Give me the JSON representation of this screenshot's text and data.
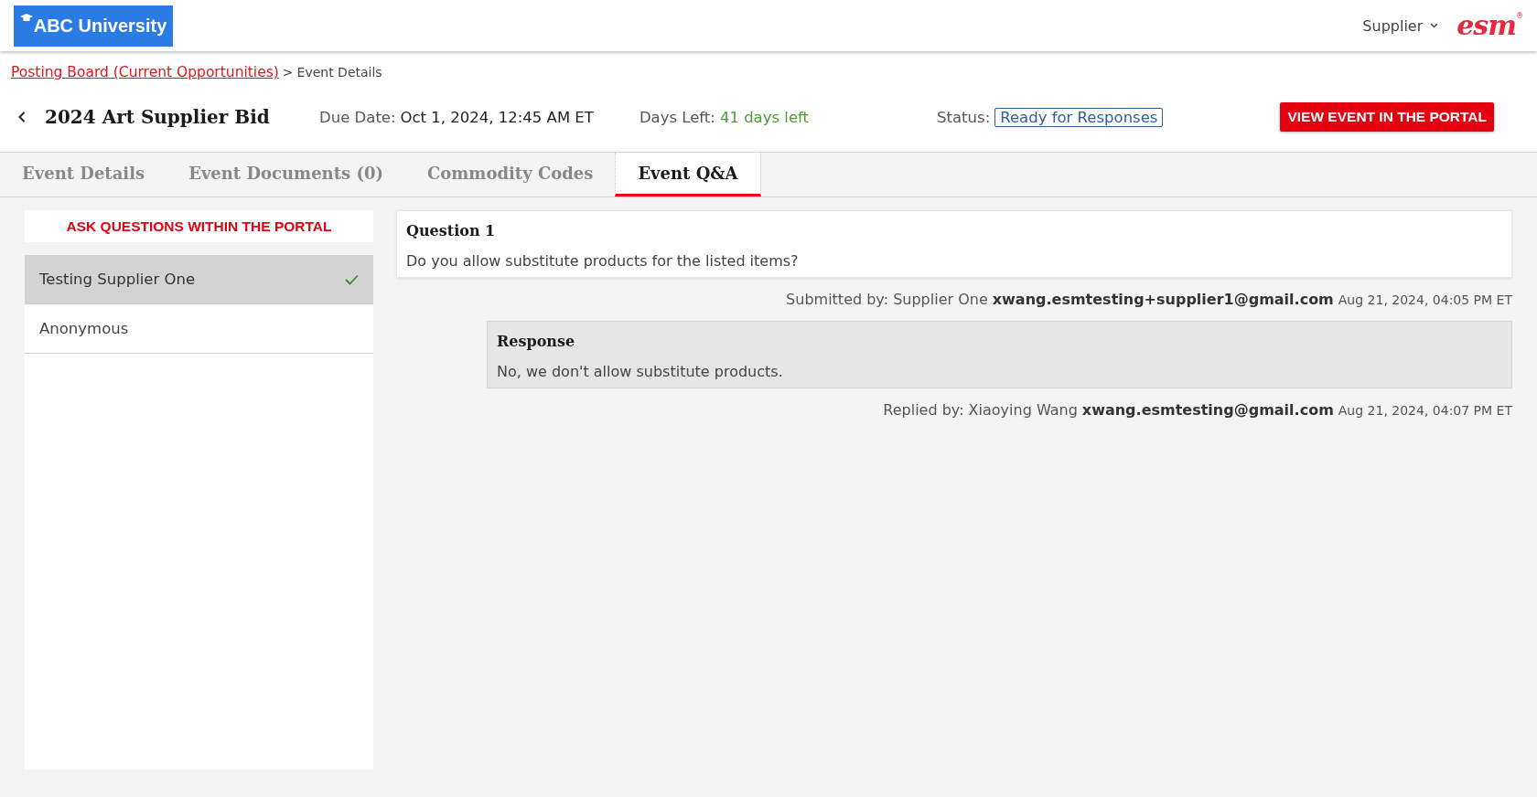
{
  "header": {
    "logo": "ABC University",
    "user_menu": "Supplier",
    "brand": "esm",
    "brand_mark": "®"
  },
  "breadcrumb": {
    "link": "Posting Board (Current Opportunities)",
    "separator": ">",
    "current": "Event Details"
  },
  "event": {
    "title": "2024 Art Supplier Bid",
    "due_label": "Due Date:",
    "due_value": "Oct 1, 2024, 12:45 AM ET",
    "days_label": "Days Left:",
    "days_value": "41 days left",
    "status_label": "Status:",
    "status_value": "Ready for Responses",
    "action": "VIEW EVENT IN THE PORTAL"
  },
  "tabs": [
    {
      "label": "Event Details",
      "selected": false
    },
    {
      "label": "Event Documents (0)",
      "selected": false
    },
    {
      "label": "Commodity Codes",
      "selected": false
    },
    {
      "label": "Event Q&A",
      "selected": true
    }
  ],
  "sidebar": {
    "ask_button": "ASK QUESTIONS WITHIN THE PORTAL",
    "items": [
      {
        "label": "Testing Supplier One",
        "selected": true
      },
      {
        "label": "Anonymous",
        "selected": false
      }
    ]
  },
  "thread": {
    "question": {
      "title": "Question 1",
      "text": "Do you allow substitute products for the listed items?"
    },
    "submitted": {
      "label": "Submitted by: Supplier One",
      "email": "xwang.esmtesting+supplier1@gmail.com",
      "time": "Aug 21, 2024, 04:05 PM ET"
    },
    "response": {
      "title": "Response",
      "text": "No, we don't allow substitute products."
    },
    "replied": {
      "label": "Replied by: Xiaoying Wang",
      "email": "xwang.esmtesting@gmail.com",
      "time": "Aug 21, 2024, 04:07 PM ET"
    }
  }
}
